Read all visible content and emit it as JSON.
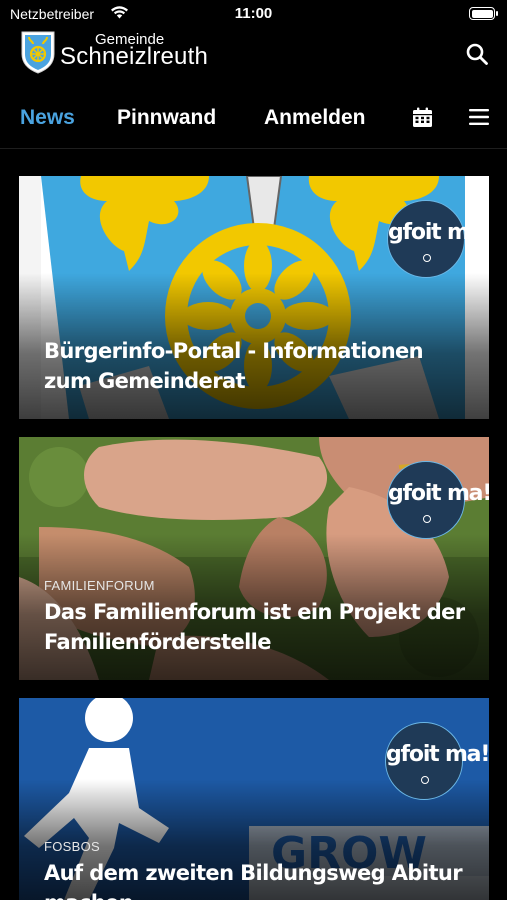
{
  "status_bar": {
    "carrier": "Netzbetreiber",
    "time": "11:00",
    "battery_level": 1.0
  },
  "header": {
    "brand_small": "Gemeinde",
    "brand_large": "Schneizlreuth",
    "logo_icon": "coat-of-arms-icon",
    "search_icon": "search-icon"
  },
  "tabs": {
    "items": [
      {
        "label": "News",
        "active": true
      },
      {
        "label": "Pinnwand",
        "active": false
      },
      {
        "label": "Anmelden",
        "active": false
      }
    ],
    "calendar_icon": "calendar-icon",
    "menu_icon": "hamburger-menu-icon",
    "active_color": "#4aa3e0"
  },
  "badge": {
    "text": "gfoit ma!"
  },
  "cards": [
    {
      "category": "",
      "title": "Bürgerinfo-Portal - Informationen zum Gemeinderat"
    },
    {
      "category": "FAMILIENFORUM",
      "title": "Das Familienforum ist ein Projekt der Familienförderstelle"
    },
    {
      "category": "FOSBOS",
      "title": "Auf dem zweiten Bildungsweg Abitur machen"
    }
  ]
}
